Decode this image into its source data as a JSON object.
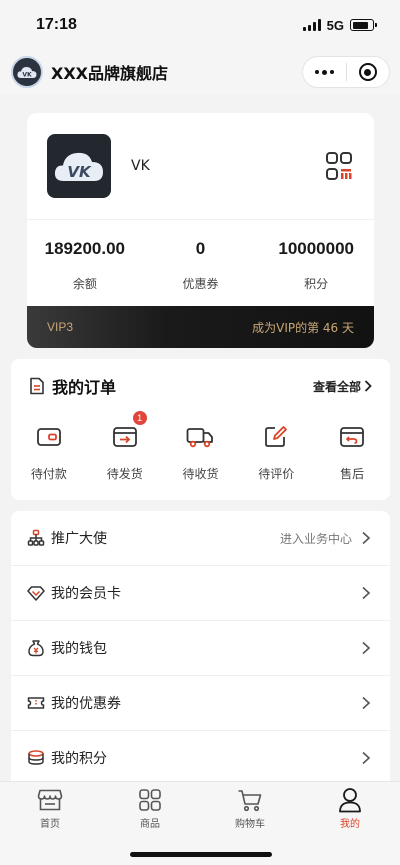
{
  "status_bar": {
    "time": "17:18",
    "network": "5G"
  },
  "nav": {
    "logo_text": "VK",
    "title": "XXX品牌旗舰店"
  },
  "profile": {
    "avatar_text": "VK",
    "username": "VK",
    "stats": [
      {
        "value": "189200.00",
        "label": "余额"
      },
      {
        "value": "0",
        "label": "优惠券"
      },
      {
        "value": "10000000",
        "label": "积分"
      }
    ],
    "vip_level": "VIP3",
    "vip_days": "成为VIP的第 46 天"
  },
  "orders": {
    "title": "我的订单",
    "view_all": "查看全部",
    "items": [
      {
        "label": "待付款",
        "icon": "wallet-icon"
      },
      {
        "label": "待发货",
        "icon": "box-arrow-icon",
        "badge": "1"
      },
      {
        "label": "待收货",
        "icon": "truck-icon"
      },
      {
        "label": "待评价",
        "icon": "edit-icon"
      },
      {
        "label": "售后",
        "icon": "return-box-icon"
      }
    ]
  },
  "menu": [
    {
      "label": "推广大使",
      "extra": "进入业务中心",
      "icon": "org-chart-icon"
    },
    {
      "label": "我的会员卡",
      "extra": "",
      "icon": "diamond-icon"
    },
    {
      "label": "我的钱包",
      "extra": "",
      "icon": "money-bag-icon"
    },
    {
      "label": "我的优惠券",
      "extra": "",
      "icon": "ticket-icon"
    },
    {
      "label": "我的积分",
      "extra": "",
      "icon": "coins-icon"
    }
  ],
  "tabs": [
    {
      "label": "首页",
      "icon": "store-icon"
    },
    {
      "label": "商品",
      "icon": "grid-icon"
    },
    {
      "label": "购物车",
      "icon": "cart-icon"
    },
    {
      "label": "我的",
      "icon": "person-icon",
      "active": true
    }
  ],
  "colors": {
    "accent": "#d8452b",
    "vip_gold": "#c9a775",
    "badge": "#e0463b"
  }
}
